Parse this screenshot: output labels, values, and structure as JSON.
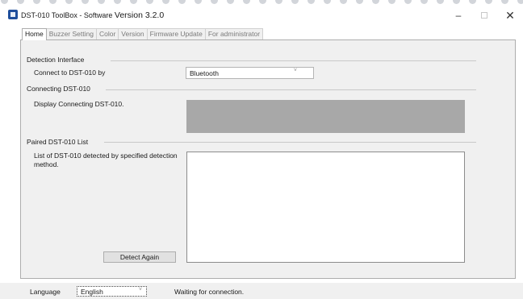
{
  "window": {
    "title_prefix": "DST-010 ToolBox - Software ",
    "title_version": "Version 3.2.0",
    "minimize_glyph": "–",
    "close_glyph": "✕"
  },
  "tabs": [
    {
      "label": "Home",
      "active": true
    },
    {
      "label": "Buzzer Setting",
      "active": false
    },
    {
      "label": "Color",
      "active": false
    },
    {
      "label": "Version",
      "active": false
    },
    {
      "label": "Firmware Update",
      "active": false
    },
    {
      "label": "For administrator",
      "active": false
    }
  ],
  "home": {
    "detection_interface": {
      "group_label": "Detection Interface",
      "connect_label": "Connect to DST-010 by",
      "connect_value": "Bluetooth"
    },
    "connecting": {
      "group_label": "Connecting DST-010",
      "display_label": "Display Connecting DST-010."
    },
    "paired": {
      "group_label": "Paired DST-010 List",
      "description": "List of DST-010 detected by specified detection method.",
      "detect_again_label": "Detect Again"
    }
  },
  "statusbar": {
    "language_label": "Language",
    "language_value": "English",
    "status_text": "Waiting for connection."
  },
  "icons": {
    "dropdown_arrow": "chevron-down-icon",
    "app": "app-icon"
  },
  "colors": {
    "connecting_display_fill": "#a8a8a8",
    "panel_background": "#f0f0f0"
  }
}
